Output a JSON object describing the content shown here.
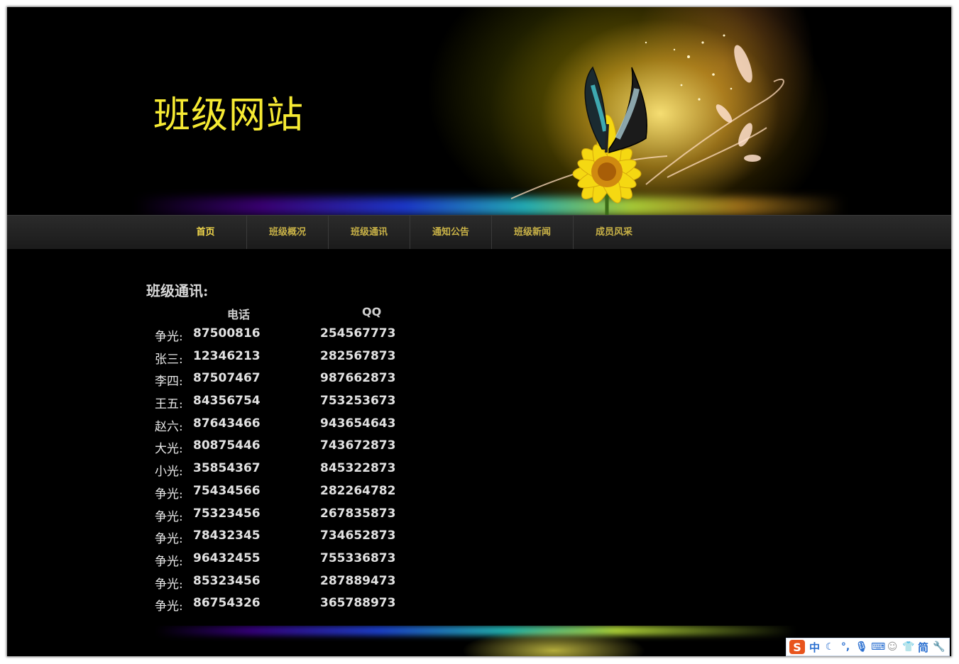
{
  "header": {
    "site_title": "班级网站"
  },
  "nav": {
    "items": [
      {
        "label": "首页"
      },
      {
        "label": "班级概况"
      },
      {
        "label": "班级通讯"
      },
      {
        "label": "通知公告"
      },
      {
        "label": "班级新闻"
      },
      {
        "label": "成员风采"
      }
    ]
  },
  "contacts": {
    "title": "班级通讯:",
    "col_phone": "电话",
    "col_qq": "QQ",
    "rows": [
      {
        "name": "争光:",
        "phone": "87500816",
        "qq": "254567773"
      },
      {
        "name": "张三:",
        "phone": "12346213",
        "qq": "282567873"
      },
      {
        "name": "李四:",
        "phone": "87507467",
        "qq": "987662873"
      },
      {
        "name": "王五:",
        "phone": "84356754",
        "qq": "753253673"
      },
      {
        "name": "赵六:",
        "phone": "87643466",
        "qq": "943654643"
      },
      {
        "name": "大光:",
        "phone": "80875446",
        "qq": "743672873"
      },
      {
        "name": "小光:",
        "phone": "35854367",
        "qq": "845322873"
      },
      {
        "name": "争光:",
        "phone": "75434566",
        "qq": "282264782"
      },
      {
        "name": "争光:",
        "phone": "75323456",
        "qq": "267835873"
      },
      {
        "name": "争光:",
        "phone": "78432345",
        "qq": "734652873"
      },
      {
        "name": "争光:",
        "phone": "96432455",
        "qq": "755336873"
      },
      {
        "name": "争光:",
        "phone": "85323456",
        "qq": "287889473"
      },
      {
        "name": "争光:",
        "phone": "86754326",
        "qq": "365788973"
      }
    ]
  },
  "ime_toolbar": {
    "logo": "S",
    "mode": "中",
    "simplified": "简",
    "icons": [
      "moon-icon",
      "punctuation-icon",
      "microphone-icon",
      "keyboard-icon",
      "user-icon",
      "shirt-icon",
      "wrench-icon"
    ]
  }
}
